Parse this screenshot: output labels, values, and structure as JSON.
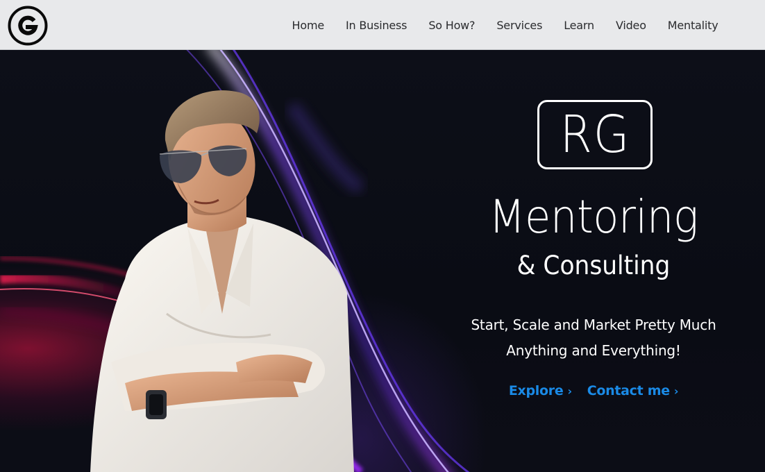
{
  "header": {
    "logo_icon": "g-circle-logo-icon",
    "nav": [
      {
        "label": "Home"
      },
      {
        "label": "In Business"
      },
      {
        "label": "So How?"
      },
      {
        "label": "Services"
      },
      {
        "label": "Learn"
      },
      {
        "label": "Video"
      },
      {
        "label": "Mentality"
      }
    ]
  },
  "hero": {
    "monogram": "RG",
    "headline": "Mentoring",
    "subheadline": "& Consulting",
    "tagline_line1": "Start, Scale and Market Pretty Much",
    "tagline_line2": "Anything and Everything!",
    "cta_explore": "Explore",
    "cta_contact": "Contact me",
    "cta_chevron": "›"
  },
  "colors": {
    "navbar_bg": "#e8e9eb",
    "hero_bg": "#0b0d14",
    "accent_link": "#1a8ae6",
    "streak_purple": "#7a3cff",
    "streak_red": "#e0184a"
  }
}
